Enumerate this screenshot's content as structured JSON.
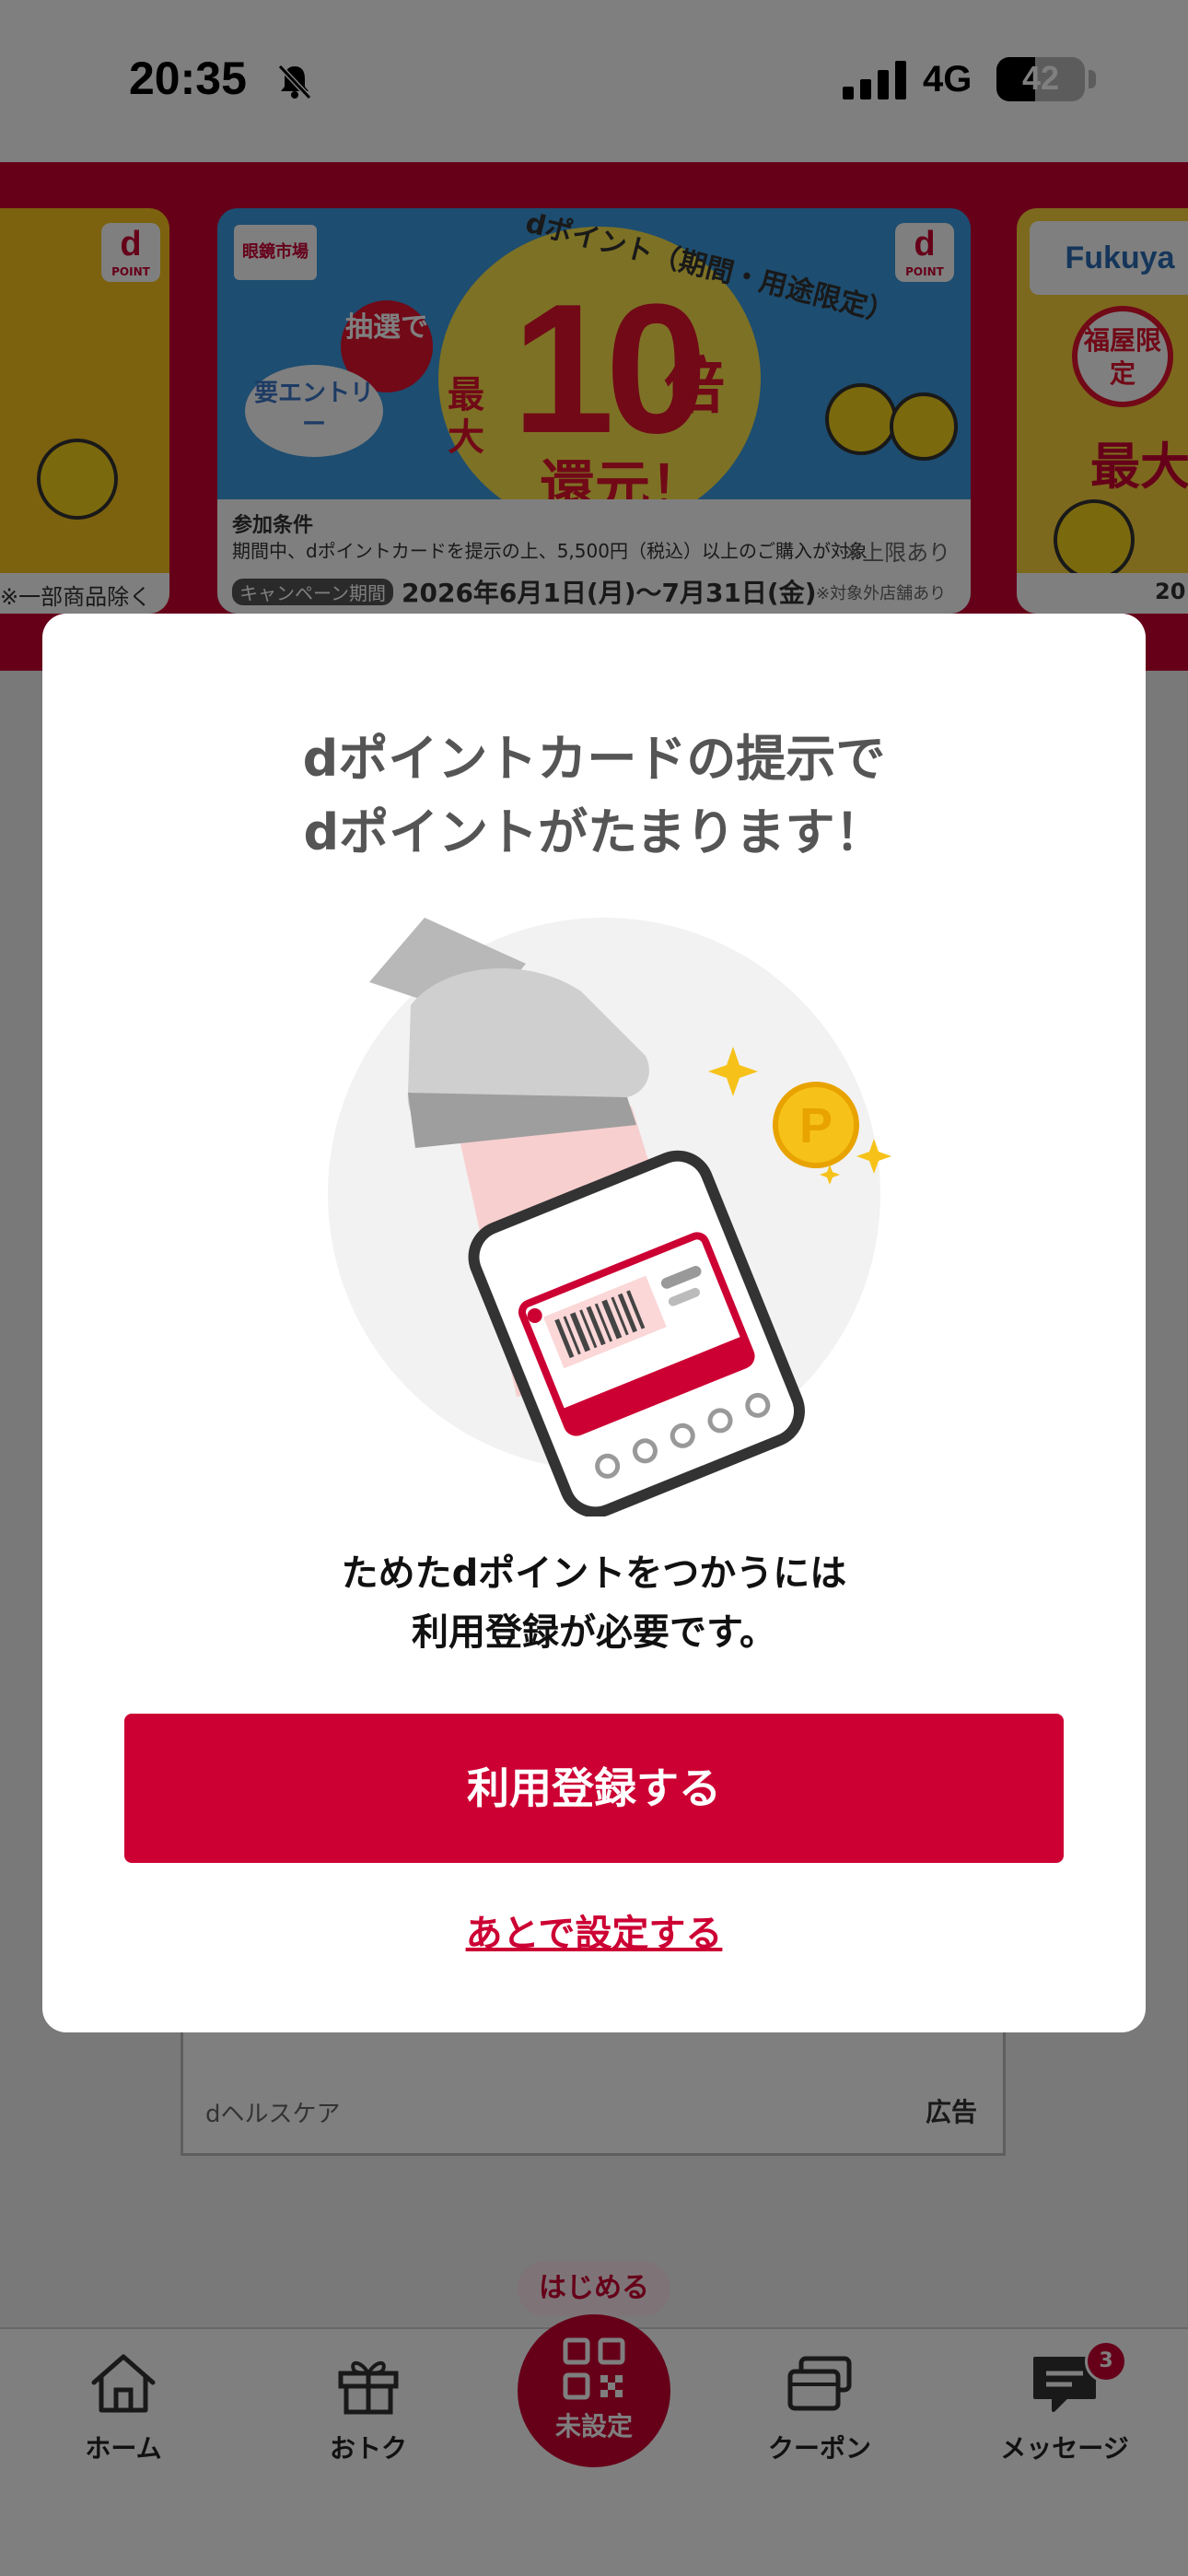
{
  "status_bar": {
    "time": "20:35",
    "network": "4G",
    "battery": "42"
  },
  "banners": {
    "left_footer": "※一部商品除く",
    "center": {
      "shop_logo": "眼鏡市場",
      "dpoint_logo": "d",
      "dpoint_small": "POINT",
      "lottery": "抽選で",
      "entry": "要エントリー",
      "dpoint_label": "dポイント（期間・用途限定）",
      "max": "最大",
      "number": "10",
      "multiplier": "倍",
      "return": "還元！",
      "condition_title": "参加条件",
      "condition": "期間中、dポイントカードを提示の上、5,500円（税込）以上のご購入が対象",
      "limit_note": "※上限あり",
      "period_label": "キャンペーン期間",
      "period": "2026年6月1日(月)〜7月31日(金)",
      "excluded_note": "※対象外店舗あり"
    },
    "right": {
      "logo": "Fukuya",
      "badge": "福屋限定",
      "max": "最大",
      "year_fragment": "20"
    }
  },
  "background": {
    "card_source": "dヘルスケア",
    "card_ad": "広告"
  },
  "modal": {
    "title_line1": "dポイントカードの提示で",
    "title_line2": "dポイントがたまります！",
    "desc_line1": "ためたdポイントをつかうには",
    "desc_line2": "利用登録が必要です。",
    "primary_button": "利用登録する",
    "later_link": "あとで設定する"
  },
  "tab_bar": {
    "home": "ホーム",
    "deals": "おトク",
    "start_pill": "はじめる",
    "center": "未設定",
    "coupon": "クーポン",
    "message": "メッセージ",
    "message_badge": "3"
  },
  "colors": {
    "brand_red": "#cc0033",
    "overlay": "rgba(0,0,0,0.5)"
  }
}
